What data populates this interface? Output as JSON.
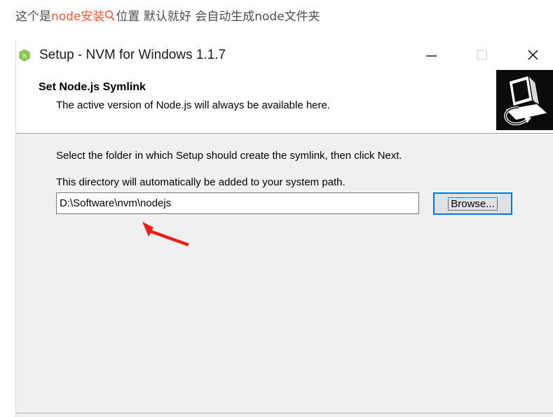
{
  "caption": {
    "prefix": "这个是",
    "link_text": "node安装",
    "suffix": "位置  默认就好  会自动生成node文件夹",
    "link_color": "#fc5531",
    "icon": "search-icon"
  },
  "window": {
    "title": "Setup - NVM for Windows 1.1.7",
    "app_icon": "nodejs-hexagon-icon",
    "controls": [
      "minimize-icon",
      "maximize-icon",
      "close-icon"
    ]
  },
  "header": {
    "title": "Set Node.js Symlink",
    "subtitle": "The active version of Node.js will always be available here.",
    "banner_icon": "computer-install-icon"
  },
  "body": {
    "instruction": "Select the folder in which Setup should create the symlink, then click Next.",
    "note": "This directory will automatically be added to your system path.",
    "path_value": "D:\\Software\\nvm\\nodejs",
    "browse_label": "Browse...",
    "annotation": "red-arrow-icon",
    "annotation_color": "#e8201a"
  }
}
